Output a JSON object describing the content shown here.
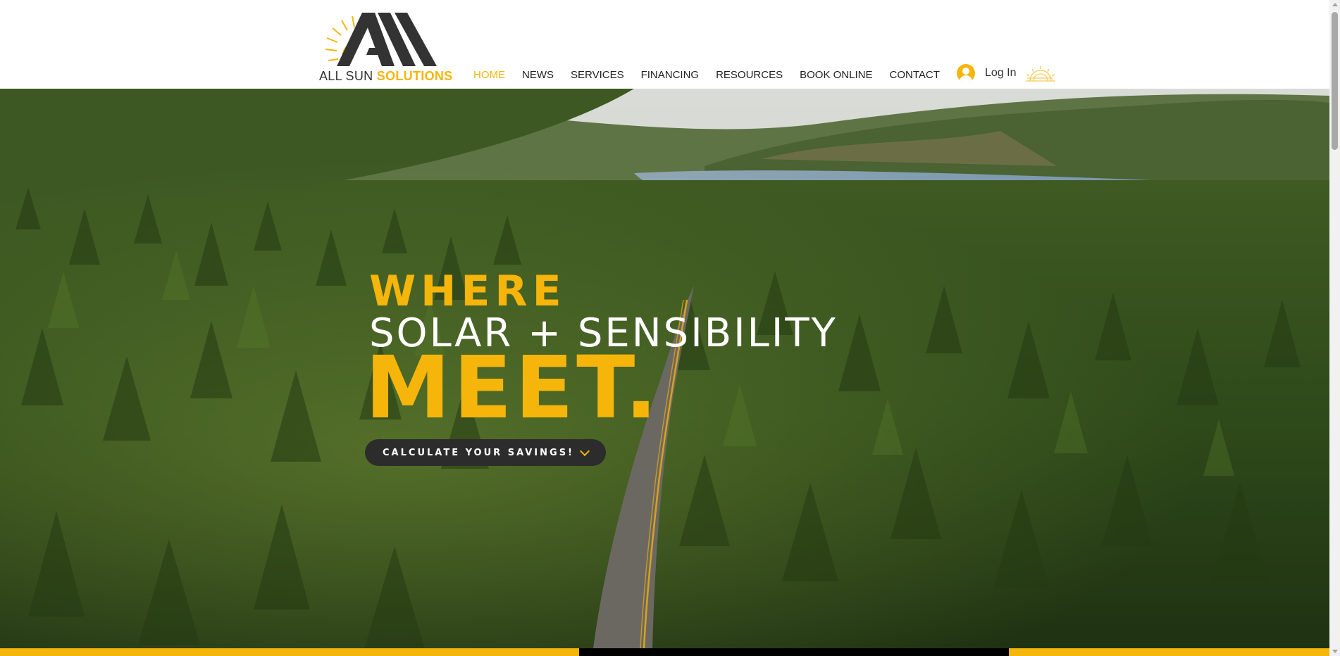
{
  "brand": {
    "name_prefix": "ALL SUN",
    "name_highlight": "SOLUTIONS",
    "logo_icon": "all-sun-logo-icon",
    "colors": {
      "accent": "#f5b50a",
      "dark": "#2c2c2c",
      "text": "#222222"
    }
  },
  "nav": {
    "items": [
      {
        "label": "HOME",
        "active": true
      },
      {
        "label": "NEWS"
      },
      {
        "label": "SERVICES"
      },
      {
        "label": "FINANCING"
      },
      {
        "label": "RESOURCES"
      },
      {
        "label": "BOOK ONLINE"
      },
      {
        "label": "CONTACT"
      }
    ]
  },
  "login": {
    "label": "Log In",
    "icon": "user-avatar-icon"
  },
  "header_icon": "sunrise-icon",
  "hero": {
    "line1": "WHERE",
    "line2": "SOLAR + SENSIBILITY",
    "line3": "MEET.",
    "cta_label": "CALCULATE YOUR SAVINGS!",
    "cta_icon": "chevron-down-icon",
    "background": "aerial forest road lake video"
  }
}
